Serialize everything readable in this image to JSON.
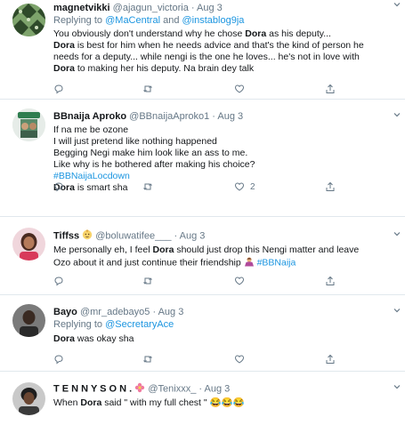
{
  "tweets": [
    {
      "name": "magnetvikki",
      "handle": "@ajagun_victoria",
      "sep": "·",
      "date": "Aug 3",
      "reply_prefix": "Replying to",
      "reply_1": "@MaCentral",
      "reply_and": "and",
      "reply_2": "@instablog9ja",
      "line1a": "You obviously don't understand why he chose ",
      "line1b": "Dora",
      "line1c": " as his deputy...",
      "line2a": "Dora",
      "line2b": " is best for him when he needs advice and that's the kind of person he",
      "line3": "needs for a deputy... while nengi is the one he loves... he's not in love with",
      "line4a": "Dora",
      "line4b": " to making her his deputy. Na brain dey talk"
    },
    {
      "name": "BBnaija Aproko",
      "handle": "@BBnaijaAproko1",
      "sep": "·",
      "date": "Aug 3",
      "line1": "If na me be ozone",
      "line2": "I will just pretend like nothing happened",
      "line3": "Begging Negi make him look like an ass to me.",
      "line4": "Like why is he bothered after making his choice?",
      "tag": "#BBNaijaLocdown",
      "line6a": "Dora",
      "line6b": " is smart sha",
      "like_count": "2"
    },
    {
      "name": "Tiffss",
      "handle": "@boluwatifee___",
      "sep": "·",
      "date": "Aug 3",
      "line1a": "Me personally eh, I feel ",
      "line1b": "Dora",
      "line1c": " should just drop this Nengi matter and leave",
      "line2a": "Ozo about it and just continue their friendship ",
      "tag": "#BBNaija"
    },
    {
      "name": "Bayo",
      "handle": "@mr_adebayo5",
      "sep": "·",
      "date": "Aug 3",
      "reply_prefix": "Replying to",
      "reply_1": "@SecretaryAce",
      "line1a": "Dora",
      "line1b": " was okay sha"
    },
    {
      "name": "T E N N Y S O N .",
      "handle": "@Tenixxx_",
      "sep": "·",
      "date": "Aug 3",
      "line1a": "When ",
      "line1b": "Dora",
      "line1c": " said \" with my full chest \" ",
      "emoji": "😂😂😂"
    }
  ],
  "colors": {
    "text": "#14171a",
    "muted": "#657786",
    "link": "#1b95e0",
    "border": "#e1e8ed"
  }
}
